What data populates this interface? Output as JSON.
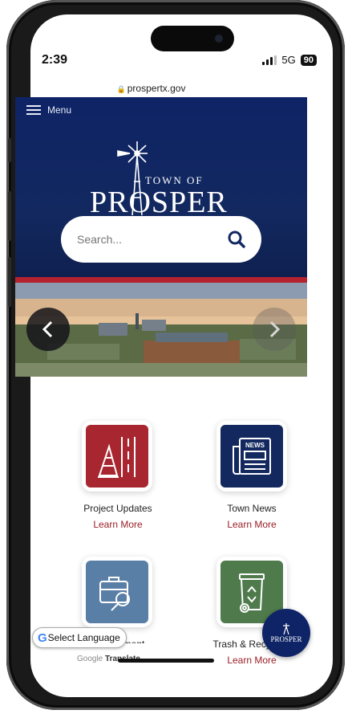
{
  "status": {
    "time": "2:39",
    "network": "5G",
    "battery": "90"
  },
  "browser": {
    "url": "prospertx.gov"
  },
  "header": {
    "menu_label": "Menu",
    "logo_small": "TOWN OF",
    "logo_big": "PROSPER",
    "search_placeholder": "Search..."
  },
  "tiles": [
    {
      "label": "Project Updates",
      "link": "Learn More",
      "color": "#a8262f",
      "icon": "construction-road-icon"
    },
    {
      "label": "Town News",
      "link": "Learn More",
      "color": "#12285f",
      "icon": "newspaper-icon",
      "badge": "NEWS"
    },
    {
      "label": "Employment",
      "link": "",
      "color": "#5a7fa6",
      "icon": "briefcase-search-icon"
    },
    {
      "label": "Trash & Recycling",
      "link": "Learn More",
      "color": "#4e7a4c",
      "icon": "recycle-bin-icon"
    }
  ],
  "translate": {
    "label": "Select Language",
    "powered": "Google",
    "powered_suffix": "Translate"
  },
  "fab": {
    "label": "PROSPER"
  }
}
